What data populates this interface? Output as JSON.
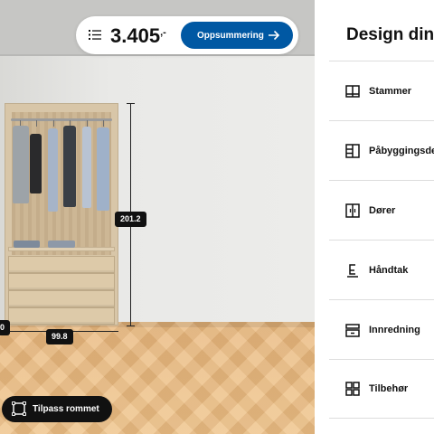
{
  "header": {
    "price": "3.405",
    "price_suffix": ",-",
    "summary_label": "Oppsummering"
  },
  "scene": {
    "height_label": "201.2",
    "width_label": "99.8",
    "depth_label": "0",
    "adjust_room_label": "Tilpass rommet"
  },
  "panel": {
    "title": "Design din P",
    "items": [
      {
        "label": "Stammer",
        "icon": "frame-icon"
      },
      {
        "label": "Påbyggingsde",
        "icon": "extension-icon"
      },
      {
        "label": "Dører",
        "icon": "door-icon"
      },
      {
        "label": "Håndtak",
        "icon": "handle-icon"
      },
      {
        "label": "Innredning",
        "icon": "interior-icon"
      },
      {
        "label": "Tilbehør",
        "icon": "accessories-icon"
      }
    ]
  },
  "colors": {
    "accent": "#0058a3",
    "dark_button": "#111111"
  }
}
